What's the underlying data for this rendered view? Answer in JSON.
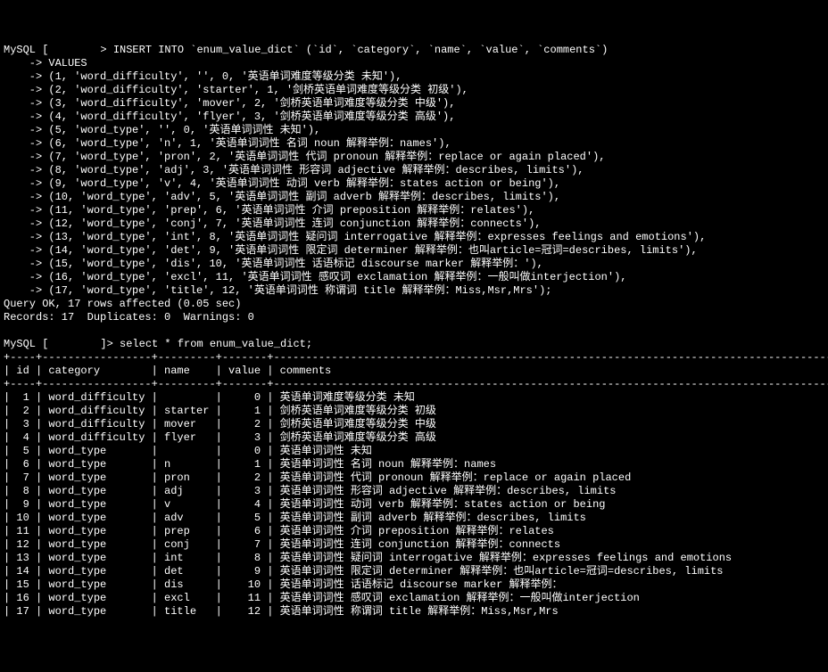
{
  "p1": "MySQL [",
  "p1b": "> INSERT INTO `enum_value_dict` (`id`, `category`, `name`, `value`, `comments`)",
  "arrow": "    -> ",
  "v0": "VALUES",
  "rows": [
    "(1, 'word_difficulty', '', 0, '英语单词难度等级分类 未知'),",
    "(2, 'word_difficulty', 'starter', 1, '剑桥英语单词难度等级分类 初级'),",
    "(3, 'word_difficulty', 'mover', 2, '剑桥英语单词难度等级分类 中级'),",
    "(4, 'word_difficulty', 'flyer', 3, '剑桥英语单词难度等级分类 高级'),",
    "(5, 'word_type', '', 0, '英语单词词性 未知'),",
    "(6, 'word_type', 'n', 1, '英语单词词性 名词 noun 解释举例：names'),",
    "(7, 'word_type', 'pron', 2, '英语单词词性 代词 pronoun 解释举例：replace or again placed'),",
    "(8, 'word_type', 'adj', 3, '英语单词词性 形容词 adjective 解释举例：describes, limits'),",
    "(9, 'word_type', 'v', 4, '英语单词词性 动词 verb 解释举例：states action or being'),",
    "(10, 'word_type', 'adv', 5, '英语单词词性 副词 adverb 解释举例：describes, limits'),",
    "(11, 'word_type', 'prep', 6, '英语单词词性 介词 preposition 解释举例：relates'),",
    "(12, 'word_type', 'conj', 7, '英语单词词性 连词 conjunction 解释举例：connects'),",
    "(13, 'word_type', 'int', 8, '英语单词词性 疑问词 interrogative 解释举例：expresses feelings and emotions'),",
    "(14, 'word_type', 'det', 9, '英语单词词性 限定词 determiner 解释举例：也叫article=冠词=describes, limits'),",
    "(15, 'word_type', 'dis', 10, '英语单词词性 话语标记 discourse marker 解释举例：'),",
    "(16, 'word_type', 'excl', 11, '英语单词词性 感叹词 exclamation 解释举例：一般叫做interjection'),",
    "(17, 'word_type', 'title', 12, '英语单词词性 称谓词 title 解释举例：Miss,Msr,Mrs');"
  ],
  "qok": "Query OK, 17 rows affected (0.05 sec)",
  "rec": "Records: 17  Duplicates: 0  Warnings: 0",
  "p2a": "MySQL [",
  "p2b": "]> select * from enum_value_dict;",
  "sep": "+----+-----------------+---------+-------+-----------------------------------------------------------------------------------------+",
  "header": "| id | category        | name    | value | comments                                                                                |",
  "table": [
    [
      "1",
      "word_difficulty",
      "",
      "0",
      "英语单词难度等级分类 未知"
    ],
    [
      "2",
      "word_difficulty",
      "starter",
      "1",
      "剑桥英语单词难度等级分类 初级"
    ],
    [
      "3",
      "word_difficulty",
      "mover",
      "2",
      "剑桥英语单词难度等级分类 中级"
    ],
    [
      "4",
      "word_difficulty",
      "flyer",
      "3",
      "剑桥英语单词难度等级分类 高级"
    ],
    [
      "5",
      "word_type",
      "",
      "0",
      "英语单词词性 未知"
    ],
    [
      "6",
      "word_type",
      "n",
      "1",
      "英语单词词性 名词 noun 解释举例：names"
    ],
    [
      "7",
      "word_type",
      "pron",
      "2",
      "英语单词词性 代词 pronoun 解释举例：replace or again placed"
    ],
    [
      "8",
      "word_type",
      "adj",
      "3",
      "英语单词词性 形容词 adjective 解释举例：describes, limits"
    ],
    [
      "9",
      "word_type",
      "v",
      "4",
      "英语单词词性 动词 verb 解释举例：states action or being"
    ],
    [
      "10",
      "word_type",
      "adv",
      "5",
      "英语单词词性 副词 adverb 解释举例：describes, limits"
    ],
    [
      "11",
      "word_type",
      "prep",
      "6",
      "英语单词词性 介词 preposition 解释举例：relates"
    ],
    [
      "12",
      "word_type",
      "conj",
      "7",
      "英语单词词性 连词 conjunction 解释举例：connects"
    ],
    [
      "13",
      "word_type",
      "int",
      "8",
      "英语单词词性 疑问词 interrogative 解释举例：expresses feelings and emotions"
    ],
    [
      "14",
      "word_type",
      "det",
      "9",
      "英语单词词性 限定词 determiner 解释举例：也叫article=冠词=describes, limits"
    ],
    [
      "15",
      "word_type",
      "dis",
      "10",
      "英语单词词性 话语标记 discourse marker 解释举例："
    ],
    [
      "16",
      "word_type",
      "excl",
      "11",
      "英语单词词性 感叹词 exclamation 解释举例：一般叫做interjection"
    ],
    [
      "17",
      "word_type",
      "title",
      "12",
      "英语单词词性 称谓词 title 解释举例：Miss,Msr,Mrs"
    ]
  ]
}
